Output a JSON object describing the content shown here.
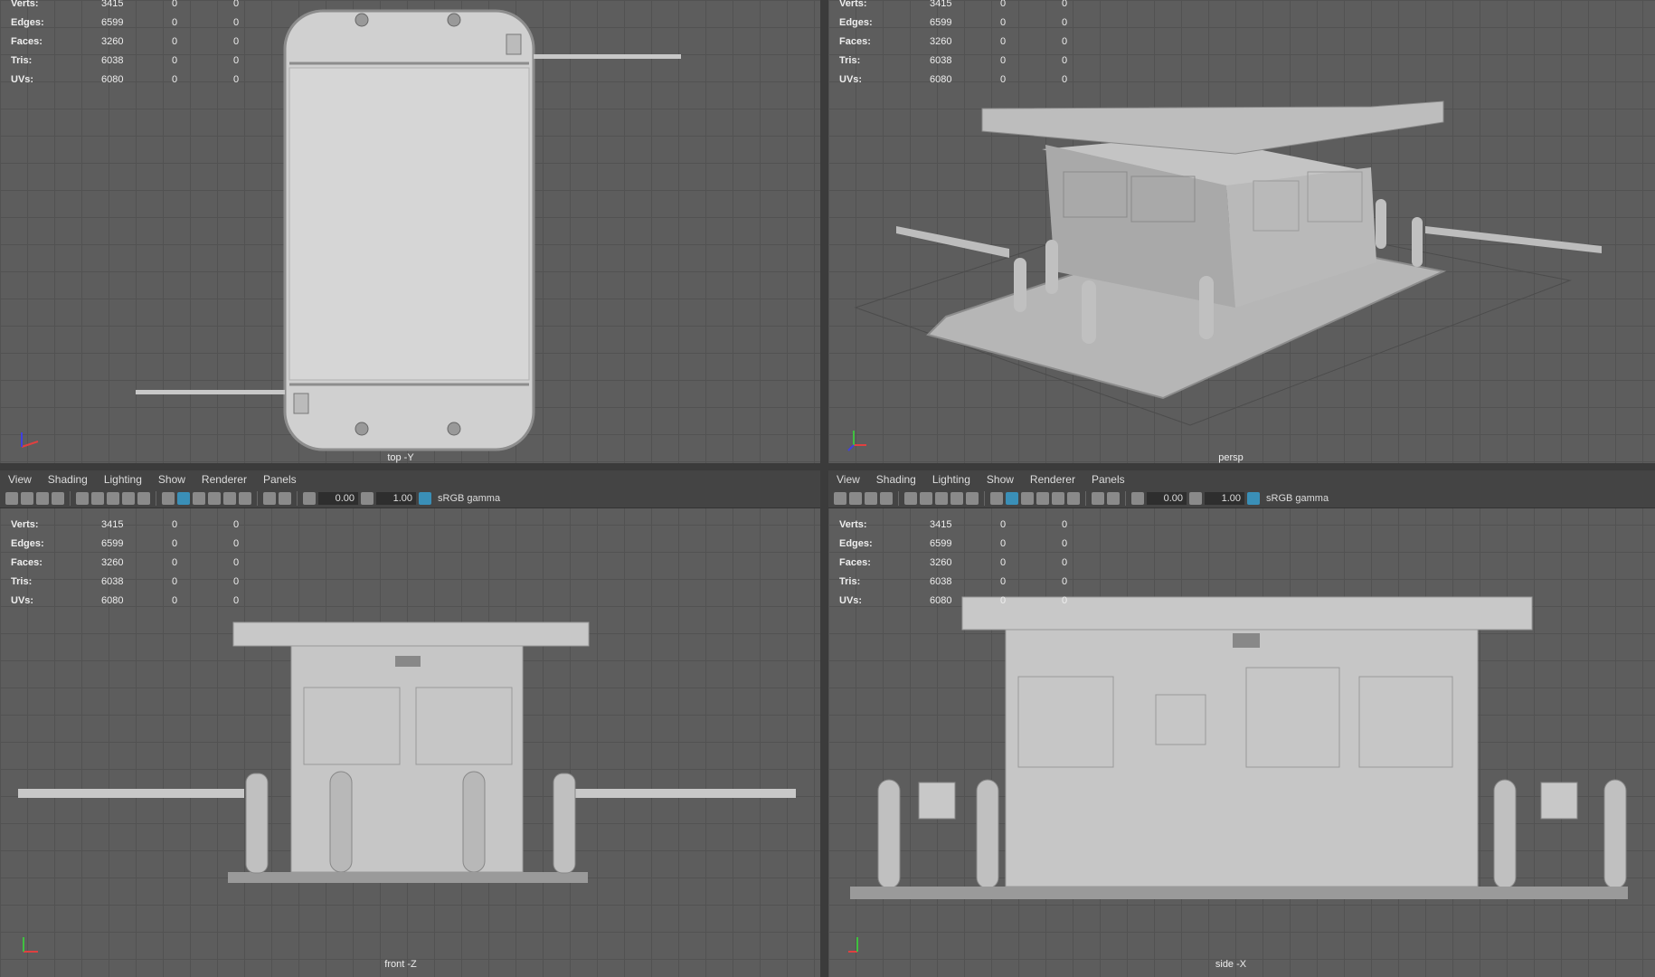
{
  "stats_labels": {
    "verts": "Verts:",
    "edges": "Edges:",
    "faces": "Faces:",
    "tris": "Tris:",
    "uvs": "UVs:"
  },
  "stats_values": {
    "verts": "3415",
    "edges": "6599",
    "faces": "3260",
    "tris": "6038",
    "uvs": "6080",
    "zero": "0"
  },
  "menu": {
    "view": "View",
    "shading": "Shading",
    "lighting": "Lighting",
    "show": "Show",
    "renderer": "Renderer",
    "panels": "Panels"
  },
  "toolbar": {
    "exposure": "0.00",
    "gamma": "1.00",
    "colorspace": "sRGB gamma"
  },
  "viewports": {
    "top": "top -Y",
    "persp": "persp",
    "front": "front -Z",
    "side": "side -X"
  },
  "axis_labels": {
    "x": "x",
    "y": "y",
    "z": "z"
  },
  "colors": {
    "bg": "#5d5d5d",
    "grid": "#525252",
    "model": "#c8c8c8",
    "accent": "#3a8fb7"
  }
}
